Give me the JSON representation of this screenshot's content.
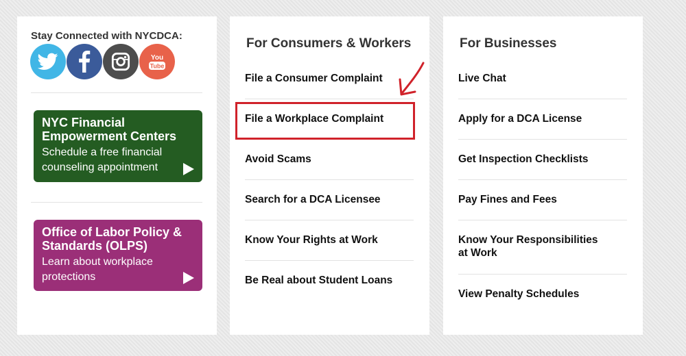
{
  "social": {
    "title": "Stay Connected with NYCDCA:",
    "items": [
      {
        "name": "twitter",
        "color": "#41b6e6"
      },
      {
        "name": "facebook",
        "color": "#3b5b9a"
      },
      {
        "name": "instagram",
        "color": "#4d4d4d"
      },
      {
        "name": "youtube",
        "color": "#e8624a",
        "label_top": "You",
        "label_bottom": "Tube"
      }
    ]
  },
  "promos": [
    {
      "title": "NYC Financial Empowerment Centers",
      "subtitle": "Schedule a free financial counseling appointment",
      "color": "#245c22"
    },
    {
      "title": "Office of Labor Policy & Standards (OLPS)",
      "subtitle": "Learn about workplace protections",
      "color": "#9b2f78"
    }
  ],
  "consumers": {
    "title": "For Consumers & Workers",
    "links": [
      "File a Consumer Complaint",
      "File a Workplace Complaint",
      "Avoid Scams",
      "Search for a DCA Licensee",
      "Know Your Rights at Work",
      "Be Real about Student Loans"
    ]
  },
  "businesses": {
    "title": "For Businesses",
    "links": [
      "Live Chat",
      "Apply for a DCA License",
      "Get Inspection Checklists",
      "Pay Fines and Fees",
      "Know Your Responsibilities at Work",
      "View Penalty Schedules"
    ]
  },
  "annotation": {
    "color": "#d0222a"
  }
}
